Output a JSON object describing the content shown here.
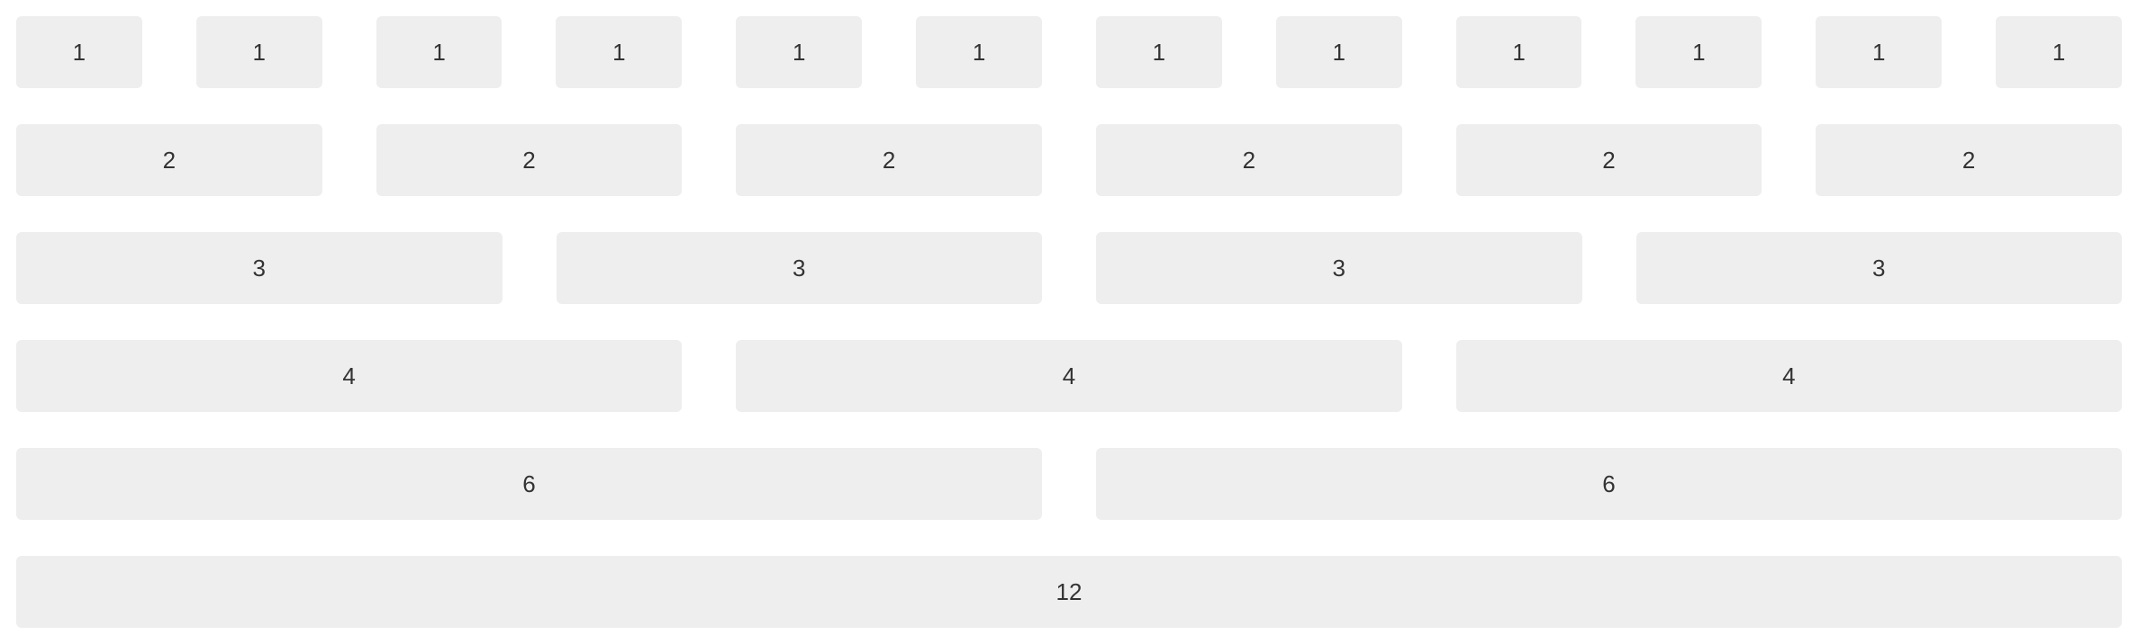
{
  "rows": [
    {
      "label": "1",
      "cells": [
        "1",
        "1",
        "1",
        "1",
        "1",
        "1",
        "1",
        "1",
        "1",
        "1",
        "1",
        "1"
      ]
    },
    {
      "label": "2",
      "cells": [
        "2",
        "2",
        "2",
        "2",
        "2",
        "2"
      ]
    },
    {
      "label": "3",
      "cells": [
        "3",
        "3",
        "3",
        "3"
      ]
    },
    {
      "label": "4",
      "cells": [
        "4",
        "4",
        "4"
      ]
    },
    {
      "label": "6",
      "cells": [
        "6",
        "6"
      ]
    },
    {
      "label": "12",
      "cells": [
        "12"
      ]
    }
  ],
  "colors": {
    "cell_background": "#eeeeee",
    "text": "#333333",
    "page_background": "#ffffff"
  }
}
